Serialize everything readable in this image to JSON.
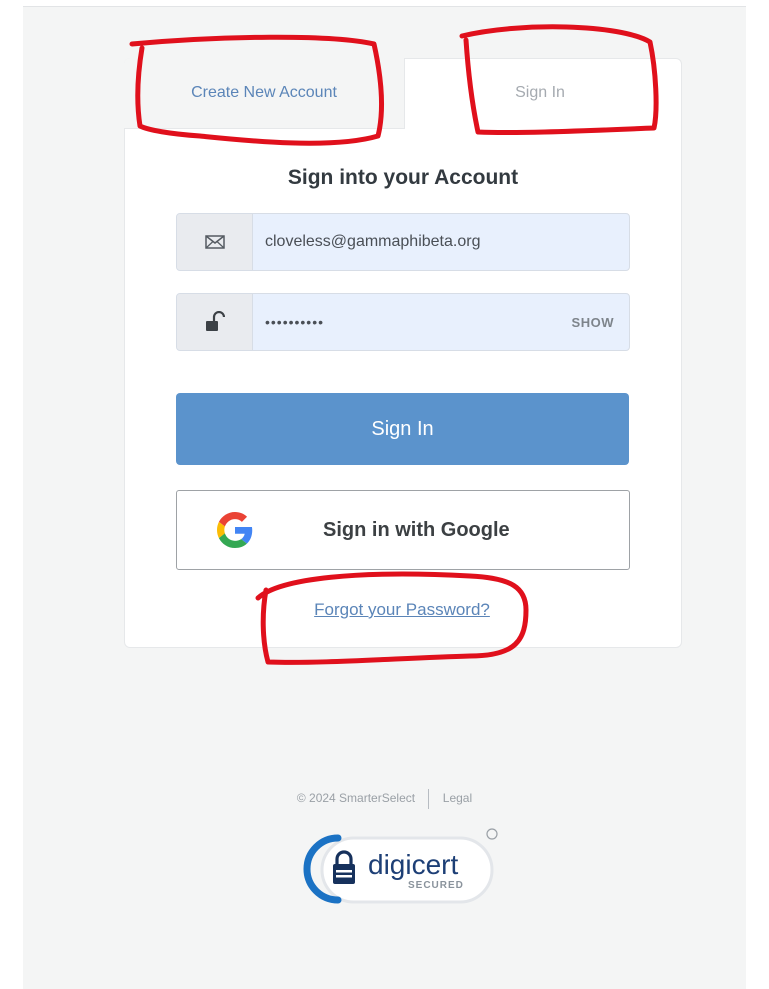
{
  "tabs": {
    "create_label": "Create New Account",
    "signin_label": "Sign In"
  },
  "heading": "Sign into your Account",
  "email": {
    "value": "cloveless@gammaphibeta.org",
    "icon": "envelope-icon"
  },
  "password": {
    "value": "••••••••••",
    "icon": "unlock-icon",
    "show_label": "SHOW"
  },
  "buttons": {
    "signin_label": "Sign In",
    "google_label": "Sign in with Google"
  },
  "forgot_link": "Forgot your Password?",
  "footer": {
    "copyright": "© 2024 SmarterSelect",
    "legal": "Legal"
  },
  "badge": {
    "brand": "digicert",
    "sub": "SECURED"
  },
  "colors": {
    "primary_button": "#5b93cc",
    "link": "#5b85b8",
    "annotation": "#e0101c",
    "input_bg": "#e8f0fd"
  }
}
